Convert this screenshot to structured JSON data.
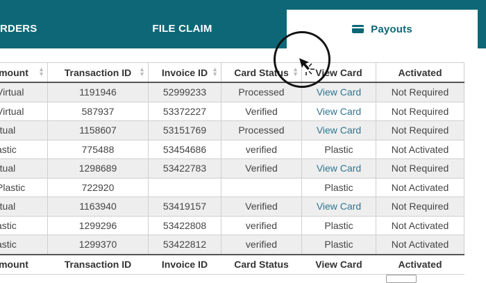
{
  "tabs": {
    "orders": "RDERS",
    "file_claim": "FILE CLAIM",
    "payouts": "Payouts"
  },
  "table": {
    "headers": [
      "mount",
      "Transaction ID",
      "Invoice ID",
      "Card Status",
      "View Card",
      "Activated"
    ],
    "footers": [
      "mount",
      "Transaction ID",
      "Invoice ID",
      "Card Status",
      "View Card",
      "Activated"
    ],
    "rows": [
      {
        "amount": "Virtual",
        "transaction_id": "1191946",
        "invoice_id": "52999233",
        "card_status": "Processed",
        "view_card": "View Card",
        "view_is_link": true,
        "activated": "Not Required"
      },
      {
        "amount": "Virtual",
        "transaction_id": "587937",
        "invoice_id": "53372227",
        "card_status": "Verified",
        "view_card": "View Card",
        "view_is_link": true,
        "activated": "Not Required"
      },
      {
        "amount": "rtual",
        "transaction_id": "1158607",
        "invoice_id": "53151769",
        "card_status": "Processed",
        "view_card": "View Card",
        "view_is_link": true,
        "activated": "Not Required"
      },
      {
        "amount": "astic",
        "transaction_id": "775488",
        "invoice_id": "53454686",
        "card_status": "verified",
        "view_card": "Plastic",
        "view_is_link": false,
        "activated": "Not Activated"
      },
      {
        "amount": "rtual",
        "transaction_id": "1298689",
        "invoice_id": "53422783",
        "card_status": "Verified",
        "view_card": "View Card",
        "view_is_link": true,
        "activated": "Not Required"
      },
      {
        "amount": "Plastic",
        "transaction_id": "722920",
        "invoice_id": "",
        "card_status": "",
        "view_card": "Plastic",
        "view_is_link": false,
        "activated": "Not Activated"
      },
      {
        "amount": "rtual",
        "transaction_id": "1163940",
        "invoice_id": "53419157",
        "card_status": "Verified",
        "view_card": "View Card",
        "view_is_link": true,
        "activated": "Not Required"
      },
      {
        "amount": "astic",
        "transaction_id": "1299296",
        "invoice_id": "53422808",
        "card_status": "verified",
        "view_card": "Plastic",
        "view_is_link": false,
        "activated": "Not Activated"
      },
      {
        "amount": "astic",
        "transaction_id": "1299370",
        "invoice_id": "53422812",
        "card_status": "verified",
        "view_card": "Plastic",
        "view_is_link": false,
        "activated": "Not Activated"
      }
    ]
  },
  "icons": {
    "payouts_tab": "credit-card-icon",
    "sort": "sort-arrows-icon"
  },
  "colors": {
    "header_bar": "#0e6777",
    "link": "#2f7590",
    "row_stripe": "#eeeeee"
  }
}
